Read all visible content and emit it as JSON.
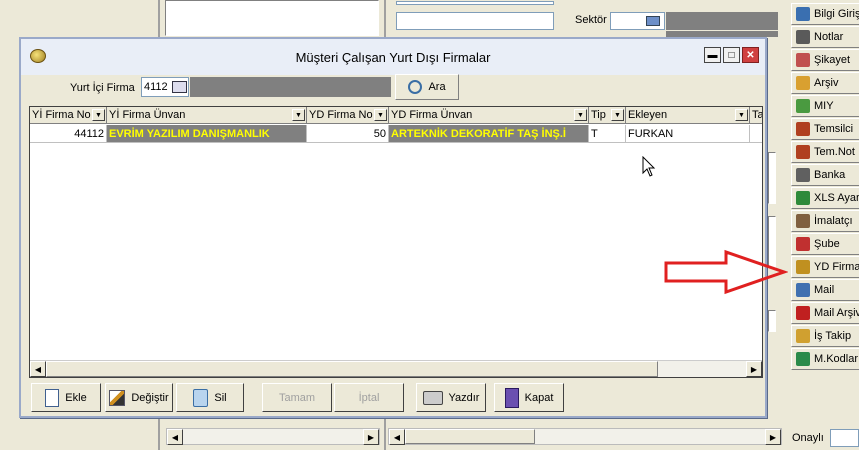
{
  "background": {
    "sektor_label": "Sektör",
    "onayli_label": "Onaylı"
  },
  "right_panel": {
    "items": [
      {
        "label": "Bilgi Girişi",
        "icon": "info-book-icon",
        "color": "#3a6fb0"
      },
      {
        "label": "Notlar",
        "icon": "notes-icon",
        "color": "#5a5a5a"
      },
      {
        "label": "Şikayet",
        "icon": "complaint-icon",
        "color": "#c05050"
      },
      {
        "label": "Arşiv",
        "icon": "archive-icon",
        "color": "#d9a030"
      },
      {
        "label": "MIY",
        "icon": "miy-icon",
        "color": "#4a9a40"
      },
      {
        "label": "Temsilci",
        "icon": "representative-icon",
        "color": "#b04020"
      },
      {
        "label": "Tem.Not",
        "icon": "rep-note-icon",
        "color": "#b04020"
      },
      {
        "label": "Banka",
        "icon": "bank-icon",
        "color": "#606060"
      },
      {
        "label": "XLS Ayar",
        "icon": "xls-icon",
        "color": "#2e8a3a"
      },
      {
        "label": "İmalatçı",
        "icon": "manufacturer-icon",
        "color": "#806040"
      },
      {
        "label": "Şube",
        "icon": "branch-icon",
        "color": "#c03030"
      },
      {
        "label": "YD Firma",
        "icon": "foreign-company-icon",
        "color": "#c09020"
      },
      {
        "label": "Mail",
        "icon": "mail-icon",
        "color": "#4070b0"
      },
      {
        "label": "Mail Arşiv",
        "icon": "mail-archive-icon",
        "color": "#c02020"
      },
      {
        "label": "İş Takip",
        "icon": "task-tracking-icon",
        "color": "#d0a030"
      },
      {
        "label": "M.Kodlar",
        "icon": "codes-icon",
        "color": "#2a8a4a"
      }
    ]
  },
  "dialog": {
    "title": "Müşteri Çalışan Yurt Dışı Firmalar",
    "yurt_ici_label": "Yurt İçi Firma",
    "yurt_ici_value": "4112",
    "search_button": "Ara",
    "columns": [
      "Yİ Firma No",
      "Yİ Firma Ünvan",
      "YD Firma No",
      "YD Firma Ünvan",
      "Tip",
      "Ekleyen",
      "Ta"
    ],
    "rows": [
      {
        "yi_no": "44112",
        "yi_unvan": "EVRİM YAZILIM DANIŞMANLIK",
        "yd_no": "50",
        "yd_unvan": "ARTEKNİK DEKORATİF TAŞ İNŞ.İ",
        "tip": "T",
        "ekleyen": "FURKAN"
      }
    ],
    "buttons": {
      "ekle": "Ekle",
      "degistir": "Değiştir",
      "sil": "Sil",
      "tamam": "Tamam",
      "iptal": "İptal",
      "yazdir": "Yazdır",
      "kapat": "Kapat"
    }
  },
  "annotation_color": "#e02020"
}
